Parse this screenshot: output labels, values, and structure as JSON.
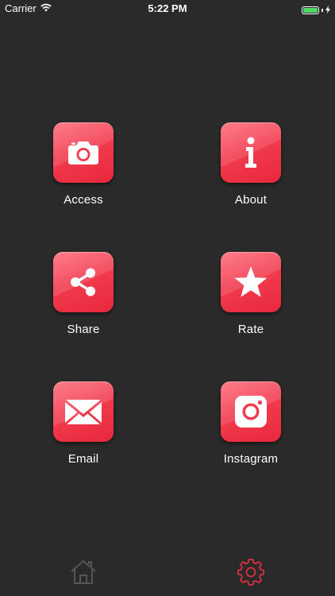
{
  "status_bar": {
    "carrier": "Carrier",
    "time": "5:22 PM",
    "battery_color": "#4cd964"
  },
  "tiles": [
    {
      "label": "Access",
      "icon": "camera-icon"
    },
    {
      "label": "About",
      "icon": "info-icon"
    },
    {
      "label": "Share",
      "icon": "share-icon"
    },
    {
      "label": "Rate",
      "icon": "star-icon"
    },
    {
      "label": "Email",
      "icon": "envelope-icon"
    },
    {
      "label": "Instagram",
      "icon": "instagram-icon"
    }
  ],
  "tab_bar": {
    "items": [
      {
        "icon": "home-icon",
        "selected": false,
        "color": "#555555"
      },
      {
        "icon": "gear-icon",
        "selected": true,
        "color": "#d9303f"
      }
    ]
  },
  "colors": {
    "background": "#2a2a2a",
    "tile_red": "#f23b4e",
    "label": "#ffffff"
  }
}
